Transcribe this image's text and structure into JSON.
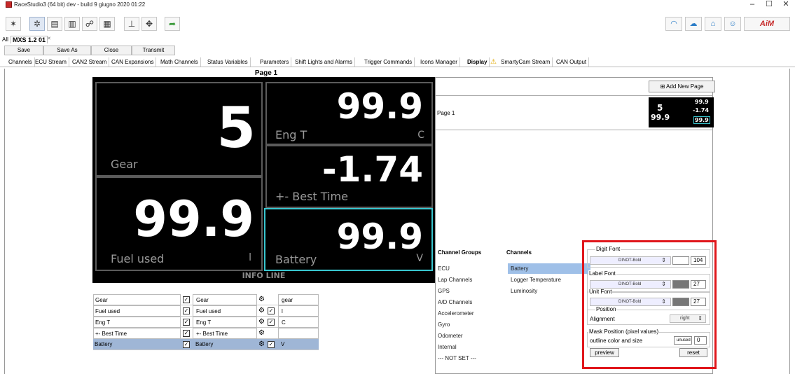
{
  "window": {
    "title": "RaceStudio3 (64 bit) dev  - build 9 giugno 2020 01:22",
    "controls": [
      "–",
      "☐",
      "✕"
    ]
  },
  "device_tabs": {
    "all_label": "All",
    "device_label": "MXS 1.2 01"
  },
  "actions": [
    "Save",
    "Save As",
    "Close",
    "Transmit"
  ],
  "tabs": [
    "Channels",
    "ECU Stream",
    "CAN2 Stream",
    "CAN Expansions",
    "Math Channels",
    "Status Variables",
    "Parameters",
    "Shift Lights and Alarms",
    "Trigger Commands",
    "Icons Manager",
    "Display",
    "SmartyCam Stream",
    "CAN Output"
  ],
  "active_tab": "Display",
  "page_title": "Page 1",
  "display": {
    "gear": {
      "value": "5",
      "label": "Gear"
    },
    "engt": {
      "value": "99.9",
      "label": "Eng T",
      "unit": "C"
    },
    "best": {
      "value": "-1.74",
      "label": "+- Best Time"
    },
    "fuel": {
      "value": "99.9",
      "label": "Fuel used",
      "unit": "l"
    },
    "batt": {
      "value": "99.9",
      "label": "Battery",
      "unit": "V"
    },
    "info_line": "INFO LINE"
  },
  "channel_rows": [
    {
      "label": "Gear",
      "channel": "Gear",
      "unit": "gear"
    },
    {
      "label": "Fuel used",
      "channel": "Fuel used",
      "unit": "l"
    },
    {
      "label": "Eng T",
      "channel": "Eng T",
      "unit": "C"
    },
    {
      "label": "+- Best Time",
      "channel": "+- Best Time",
      "unit": ""
    },
    {
      "label": "Battery",
      "channel": "Battery",
      "unit": "V"
    }
  ],
  "right_panel": {
    "add_page_label": "Add New Page",
    "page_row_label": "Page 1",
    "thumb": {
      "v1": "5",
      "v2": "99.9",
      "v3": "-1.74",
      "v4": "99.9",
      "v5": "99.9"
    },
    "channel_groups_header": "Channel Groups",
    "channels_header": "Channels",
    "groups": [
      "ECU",
      "Lap Channels",
      "GPS",
      "A/D Channels",
      "Accelerometer",
      "Gyro",
      "Odometer",
      "Internal",
      "--- NOT SET ---"
    ],
    "channels": [
      "Battery",
      "Logger Temperature",
      "Luminosity"
    ],
    "selected_channel": "Battery"
  },
  "font_panel": {
    "digit_font": {
      "title": "Digit Font",
      "font": "DINOT-Bold",
      "color": "#ffffff",
      "size": "104"
    },
    "label_font": {
      "title": "Label Font",
      "font": "DINOT-Bold",
      "color": "#777777",
      "size": "27"
    },
    "unit_font": {
      "title": "Unit Font",
      "font": "DINOT-Bold",
      "color": "#777777",
      "size": "27"
    },
    "position": {
      "title": "Position",
      "alignment_label": "Alignment",
      "alignment_value": "right"
    },
    "mask": {
      "title": "Mask Position (pixel values)",
      "outline_label": "outline color and size",
      "outline_color": "unused",
      "outline_size": "0"
    },
    "preview_label": "preview",
    "reset_label": "reset"
  },
  "colors": {
    "highlight": "#e0161b",
    "selection": "#38c6cf"
  }
}
